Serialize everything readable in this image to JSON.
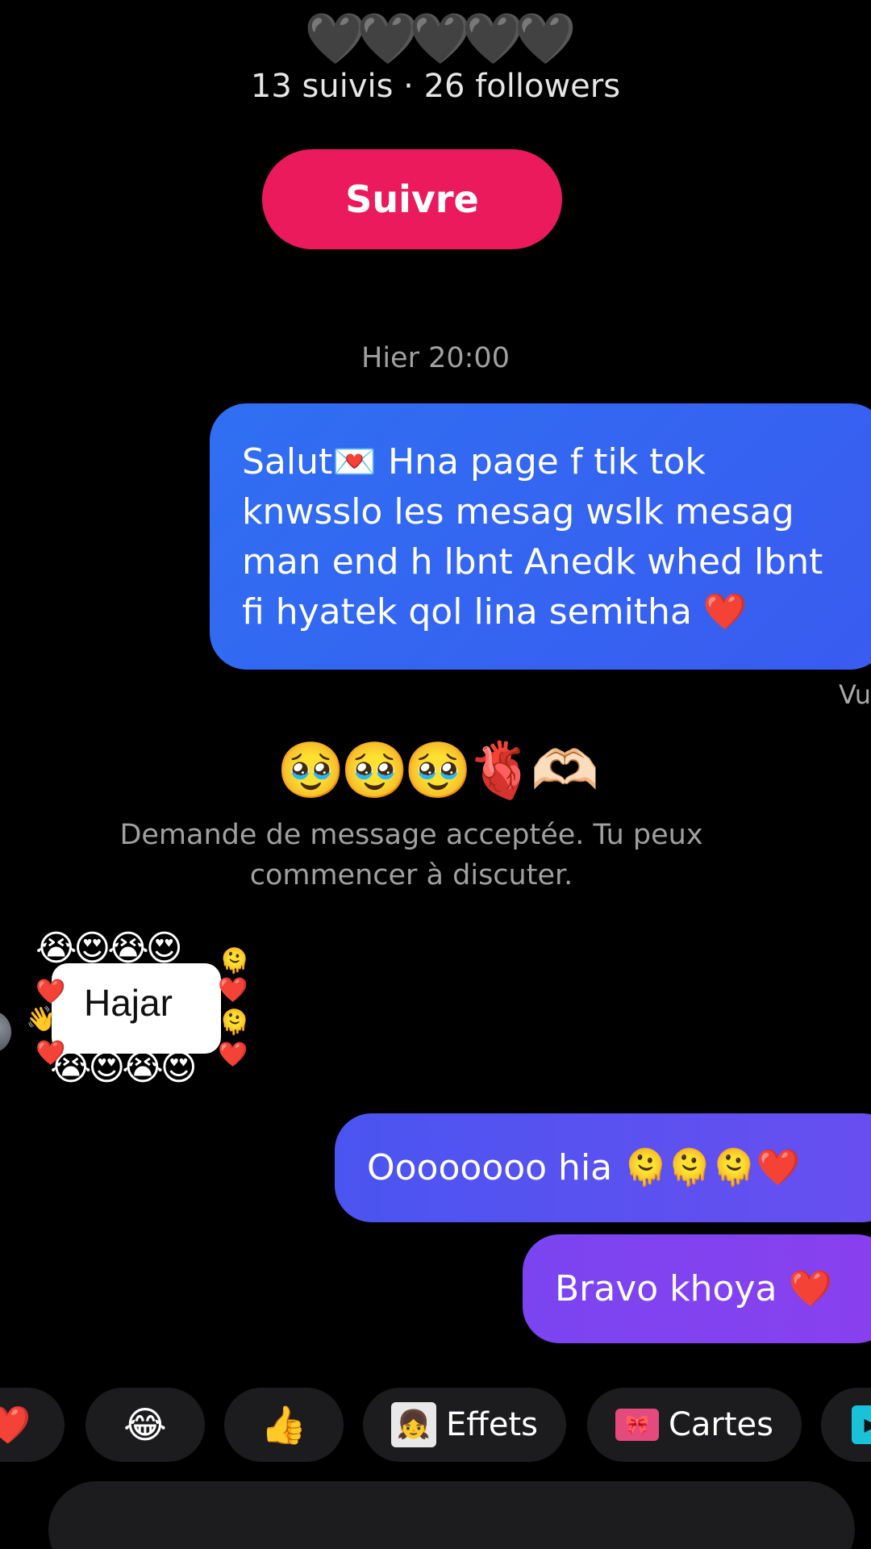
{
  "profile": {
    "name_display": "🖤🖤🖤🖤🖤",
    "stats": "13 suivis · 26 followers",
    "follow_label": "Suivre"
  },
  "chat": {
    "timestamp": "Hier 20:00",
    "messages": [
      {
        "text": "Salut💌 Hna page f tik tok knwsslo les mesag wslk mesag man end h lbnt Anedk whed lbnt fi hyatek qol lina semitha ❤️"
      },
      {
        "text": "Oooooooo hia 🫠🫠🫠❤️"
      },
      {
        "text": "Bravo khoya ❤️"
      }
    ],
    "seen_label": "Vu",
    "peer_emoji_name": "🥹🥹🥹🫀🫶🏻",
    "system_message": "Demande de message acceptée. Tu peux commencer à discuter.",
    "sticker": {
      "name": "Hajar",
      "top_row": "😭😍😭😍",
      "bottom_row": "😭😍😭😍"
    }
  },
  "quick_actions": [
    {
      "icon": "❤️",
      "label": ""
    },
    {
      "icon": "😂",
      "label": ""
    },
    {
      "icon": "👍",
      "label": ""
    },
    {
      "icon": "effects-icon",
      "label": "Effets"
    },
    {
      "icon": "cards-icon",
      "label": "Cartes"
    },
    {
      "icon": "play-icon",
      "label": ""
    }
  ]
}
